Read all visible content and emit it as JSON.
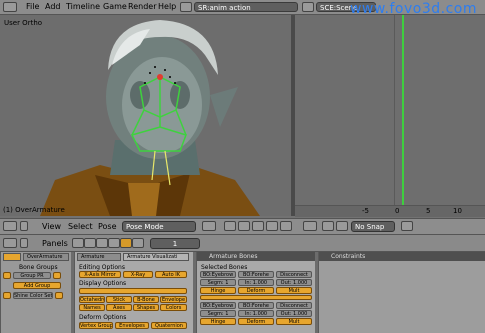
{
  "menubar": {
    "items": [
      "File",
      "Add",
      "Timeline",
      "Game",
      "Render",
      "Help"
    ],
    "screen_name": "SR:anim action",
    "scene_name": "SCE:Scene"
  },
  "watermark": "www.fovo3d.com",
  "viewport": {
    "view_label": "User Ortho",
    "status": "(1) OverArmature"
  },
  "timeline": {
    "ticks": [
      "-5",
      "0",
      "5",
      "10"
    ]
  },
  "viewport_header": {
    "view": "View",
    "select": "Select",
    "pose": "Pose",
    "mode": "Pose Mode"
  },
  "timeline_header": {
    "snap": "No Snap"
  },
  "buttons_header": {
    "panels": "Panels",
    "frame": "1"
  },
  "panels": {
    "left_tabs": [
      "OverArmature",
      "Bone Groups"
    ],
    "left_buttons": [
      "Group PR",
      "Add Group",
      "Shine Color Set"
    ],
    "armature_tab": "Armature",
    "armature_tab2": "Armature Visualizati",
    "editing_options": "Editing Options",
    "xaxis_mirror": "X-Axis Mirror",
    "xray": "X-Ray",
    "auto_ik": "Auto IK",
    "display_options": "Display Options",
    "display_buttons": [
      "Octahedron",
      "Stick",
      "B-Bone",
      "Envelope",
      "Names",
      "Axes",
      "Shapes",
      "Colors"
    ],
    "deform_options": "Deform Options",
    "deform_buttons": [
      "Vertex Groups",
      "Envelopes",
      "Quaternion"
    ],
    "armature_bones_tab": "Armature Bones",
    "selected_bones": "Selected Bones",
    "bone_rows": [
      {
        "name": "BO:Eyebrow",
        "parent": "BO:Forehe",
        "field": "Disconnect"
      },
      {
        "name": "Segm: 1",
        "parent": "In: 1.000",
        "field": "Out: 1.000"
      },
      {
        "name": "Hinge",
        "parent": "Deform",
        "field": "Mult"
      },
      {
        "name": "BO:Eyebrow",
        "parent": "BO:Forehe",
        "field": "Disconnect"
      },
      {
        "name": "Segm: 1",
        "parent": "In: 1.000",
        "field": "Out: 1.000"
      },
      {
        "name": "Hinge",
        "parent": "Deform",
        "field": "Mult"
      }
    ],
    "constraints_tab": "Constraints"
  },
  "colors": {
    "orange": "#e7a62e",
    "timeline_cursor": "#3ecf3e",
    "watermark": "#2d7df0"
  }
}
